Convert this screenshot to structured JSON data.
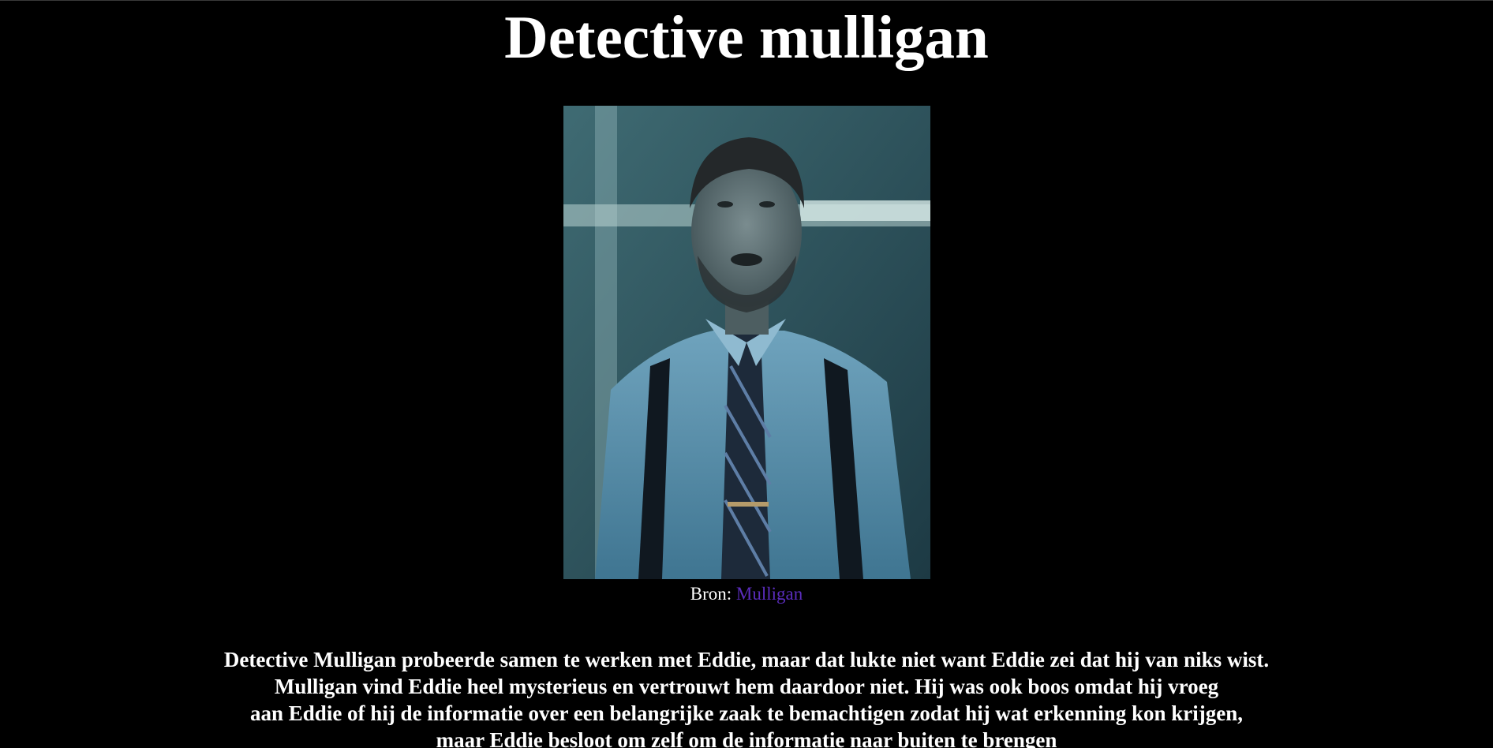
{
  "page": {
    "title": "Detective mulligan"
  },
  "figure": {
    "caption_prefix": "Bron:",
    "caption_link": "Mulligan",
    "link_color": "#5b2dbd"
  },
  "description": {
    "lines": [
      "Detective Mulligan probeerde samen te werken met Eddie, maar dat lukte niet want Eddie zei dat hij van niks wist.",
      "Mulligan vind Eddie heel mysterieus en vertrouwt hem daardoor niet. Hij was ook boos omdat hij vroeg",
      "aan Eddie of hij de informatie over een belangrijke zaak te bemachtigen zodat hij wat erkenning kon krijgen,",
      "maar Eddie besloot om zelf om de informatie naar buiten te brengen"
    ]
  }
}
